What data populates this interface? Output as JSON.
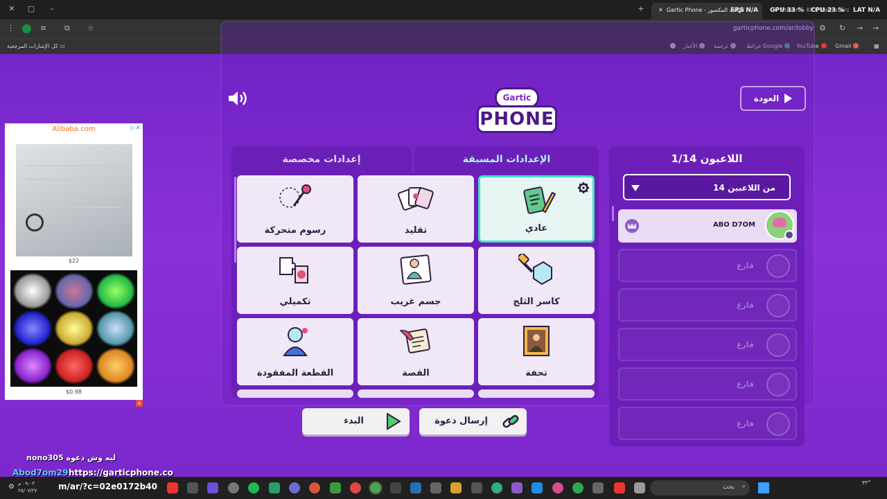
{
  "browser": {
    "active_tab": "Gartic Phone - الهاتف المكسور",
    "other_tab": "Stream - Kick Dashboard",
    "hud": {
      "fps": "FPS  N/A",
      "gpu": "GPU  33 %",
      "cpu": "CPU  23 %",
      "lat": "LAT  N/A"
    },
    "url": "garticphone.com/ar/lobby",
    "bookmarks": {
      "all": "كل الإشارات المرجعية",
      "gmail": "Gmail",
      "youtube": "YouTube",
      "maps": "خرائط Google",
      "translate": "ترجمة",
      "news": "الأخبار"
    }
  },
  "lobby": {
    "back_label": "العودة",
    "logo_top": "Gartic",
    "logo_bottom": "PHONE",
    "players_title": "اللاعبون 1/14",
    "max_players": "14 من اللاعبين",
    "player_name": "ABO D7OM",
    "empty_label": "فارغ",
    "tabs": {
      "presets": "الإعدادات المسبقة",
      "custom": "إعدادات مخصصة"
    },
    "modes": [
      {
        "label": "عادي"
      },
      {
        "label": "تقليد"
      },
      {
        "label": "رسوم متحركة"
      },
      {
        "label": "كاسر الثلج"
      },
      {
        "label": "جسم غريب"
      },
      {
        "label": "تكميلي"
      },
      {
        "label": "تحفة"
      },
      {
        "label": "القصة"
      },
      {
        "label": "القطعة المفقودة"
      }
    ],
    "start_label": "البدء",
    "invite_label": "إرسال دعوة"
  },
  "ad": {
    "brand": "Alibaba.com",
    "price1": "$22",
    "price2": "$0.98",
    "corner": "A"
  },
  "overlay": {
    "line1": "nono305  ليه وش دعوه",
    "line2_user": "Abod7om29",
    "line2_text": "https://garticphone.co",
    "line3": "m/ar/?c=02e0172b40"
  },
  "taskbar": {
    "time": "٠٩:٠٣ م",
    "date": "٢٥/٠٧/٢٧",
    "search": "بحث",
    "tray_num": "٣٣°"
  },
  "colors": {
    "page": "#7a2ad0",
    "panel_dark": "#6c1fb8",
    "accent_teal": "#45e0c4",
    "tab_active_text": "#a9f7ea",
    "card": "#f0e8f7"
  }
}
